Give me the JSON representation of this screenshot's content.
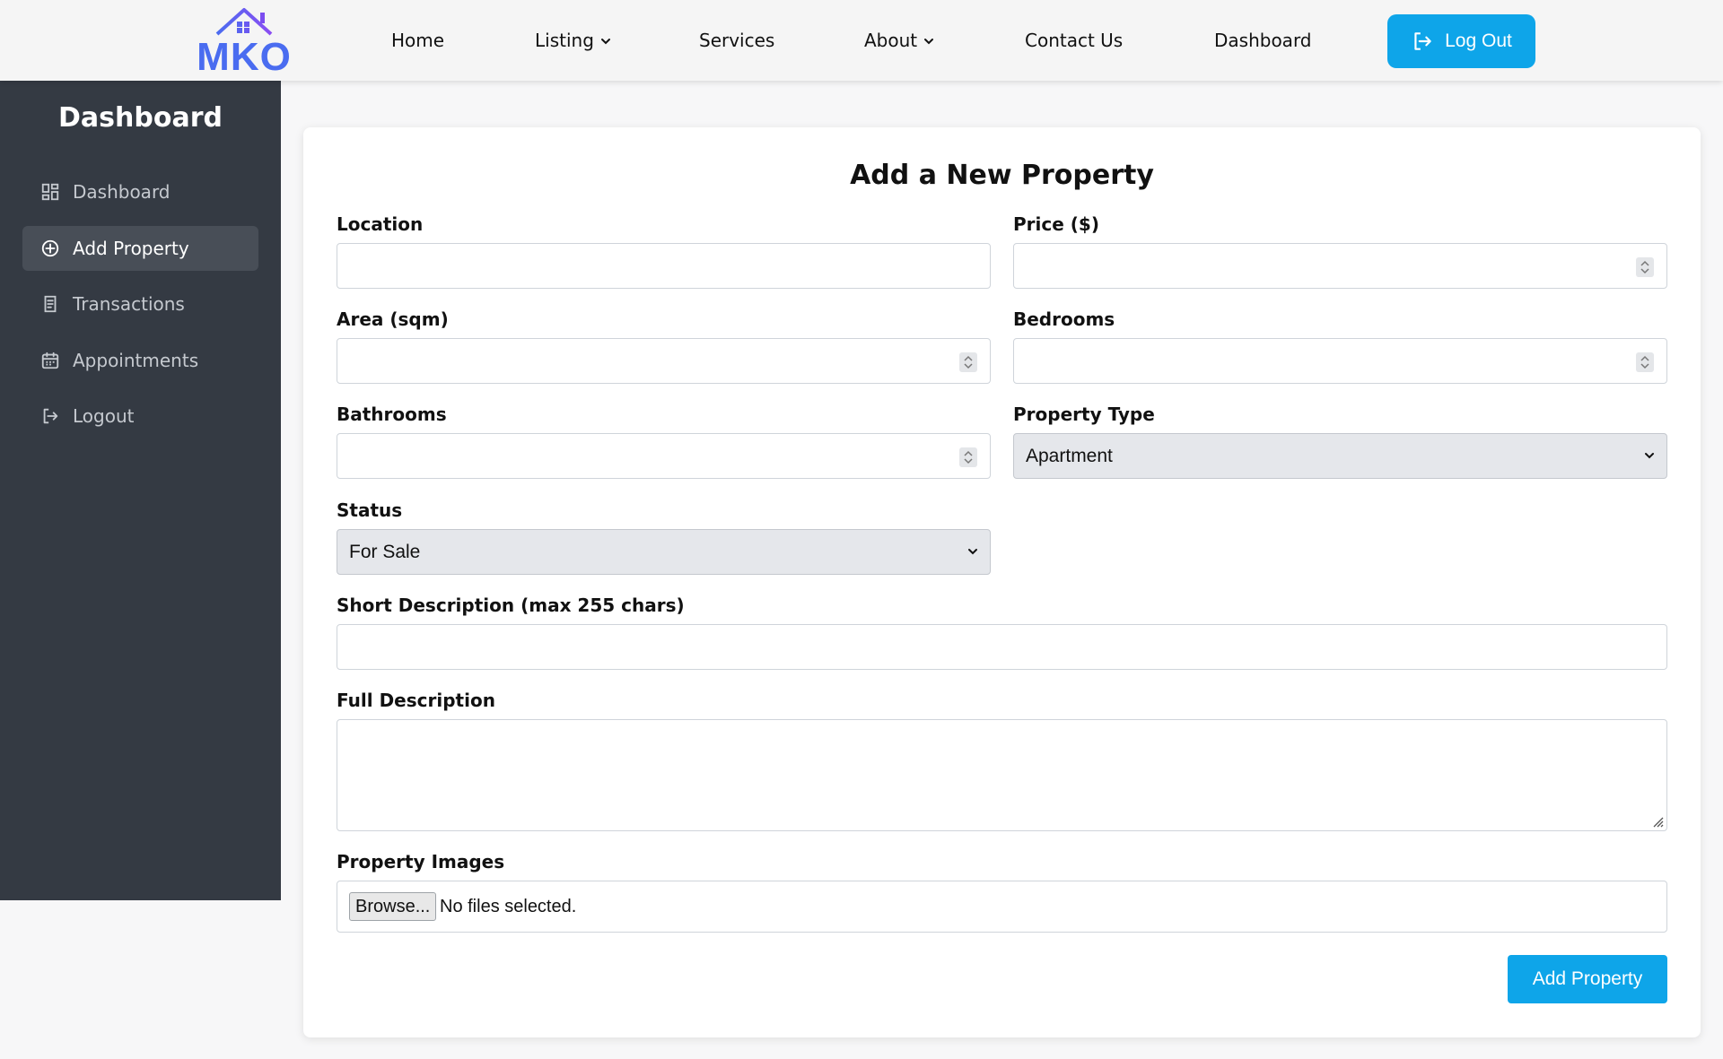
{
  "brand": {
    "logo_text": "MKO",
    "colors": {
      "logo_blue": "#4a6cf0",
      "logo_purple": "#7c4df0"
    }
  },
  "nav": {
    "home": "Home",
    "listing": "Listing",
    "services": "Services",
    "about": "About",
    "contact": "Contact Us",
    "dashboard": "Dashboard",
    "logout": "Log Out"
  },
  "sidebar": {
    "title": "Dashboard",
    "items": [
      {
        "label": "Dashboard",
        "icon": "grid-icon",
        "active": false
      },
      {
        "label": "Add Property",
        "icon": "plus-circle-icon",
        "active": true
      },
      {
        "label": "Transactions",
        "icon": "receipt-icon",
        "active": false
      },
      {
        "label": "Appointments",
        "icon": "calendar-icon",
        "active": false
      },
      {
        "label": "Logout",
        "icon": "logout-icon",
        "active": false
      }
    ]
  },
  "form": {
    "title": "Add a New Property",
    "location": {
      "label": "Location",
      "value": ""
    },
    "price": {
      "label": "Price ($)",
      "value": ""
    },
    "area": {
      "label": "Area (sqm)",
      "value": ""
    },
    "bedrooms": {
      "label": "Bedrooms",
      "value": ""
    },
    "bathrooms": {
      "label": "Bathrooms",
      "value": ""
    },
    "property_type": {
      "label": "Property Type",
      "selected": "Apartment"
    },
    "status": {
      "label": "Status",
      "selected": "For Sale"
    },
    "short_description": {
      "label": "Short Description (max 255 chars)",
      "value": ""
    },
    "full_description": {
      "label": "Full Description",
      "value": ""
    },
    "images": {
      "label": "Property Images",
      "browse_label": "Browse...",
      "status_text": "No files selected."
    },
    "submit_label": "Add Property"
  },
  "theme": {
    "accent": "#0ea5e9",
    "sidebar_bg": "#343a43",
    "sidebar_active_bg": "#484e57"
  }
}
